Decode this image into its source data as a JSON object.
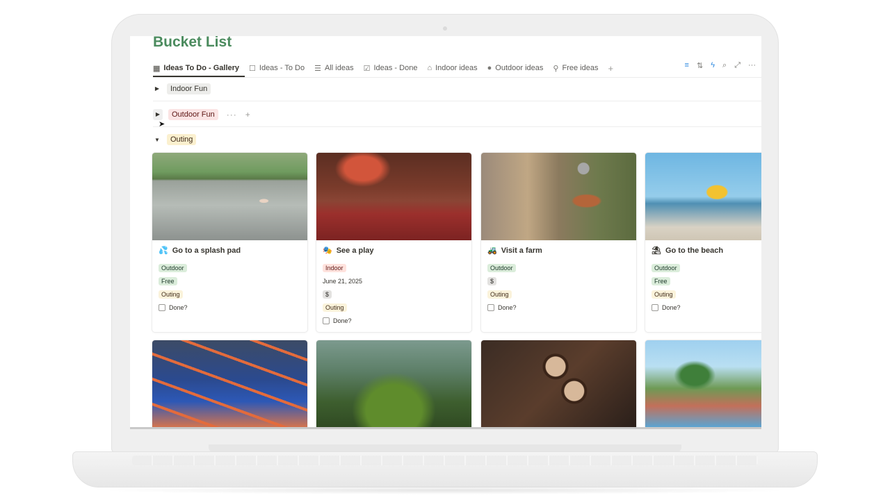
{
  "page": {
    "title": "Bucket List"
  },
  "tabs": [
    {
      "label": "Ideas To Do - Gallery",
      "icon": "gallery-icon",
      "active": true
    },
    {
      "label": "Ideas - To Do",
      "icon": "checkbox-icon"
    },
    {
      "label": "All ideas",
      "icon": "list-icon"
    },
    {
      "label": "Ideas - Done",
      "icon": "checked-box-icon"
    },
    {
      "label": "Indoor ideas",
      "icon": "house-icon"
    },
    {
      "label": "Outdoor ideas",
      "icon": "tree-icon"
    },
    {
      "label": "Free ideas",
      "icon": "location-pin-icon"
    }
  ],
  "tab_add": "+",
  "toolbar": {
    "icons": [
      "filter-icon",
      "sort-icon",
      "automation-icon",
      "search-icon",
      "expand-icon",
      "more-icon"
    ]
  },
  "groups": [
    {
      "label": "Indoor Fun",
      "expanded": false,
      "color": "gray"
    },
    {
      "label": "Outdoor Fun",
      "expanded": false,
      "color": "red",
      "actions": "···",
      "add": "+"
    },
    {
      "label": "Outing",
      "expanded": true,
      "color": "yellow"
    }
  ],
  "cards": [
    {
      "emoji": "💦",
      "title": "Go to a splash pad",
      "tags": [
        "Outdoor",
        "Free",
        "Outing"
      ],
      "date": "",
      "done_label": "Done?"
    },
    {
      "emoji": "🎭",
      "title": "See a play",
      "tags": [
        "Indoor"
      ],
      "date": "June 21, 2025",
      "cost": "$",
      "tags2": [
        "Outing"
      ],
      "done_label": "Done?"
    },
    {
      "emoji": "🚜",
      "title": "Visit a farm",
      "tags": [
        "Outdoor"
      ],
      "cost": "$",
      "tags2": [
        "Outing"
      ],
      "done_label": "Done?"
    },
    {
      "emoji": "⛱",
      "title": "Go to the beach",
      "tags": [
        "Outdoor",
        "Free",
        "Outing"
      ],
      "done_label": "Done?"
    }
  ],
  "colors": {
    "title_green": "#4b8b5e",
    "tag_green": "#dbeddb",
    "tag_red": "#ffe2dd",
    "tag_yellow": "#fbf3db",
    "tag_gray": "#e3e2e0",
    "accent_blue": "#2f8ae0"
  }
}
